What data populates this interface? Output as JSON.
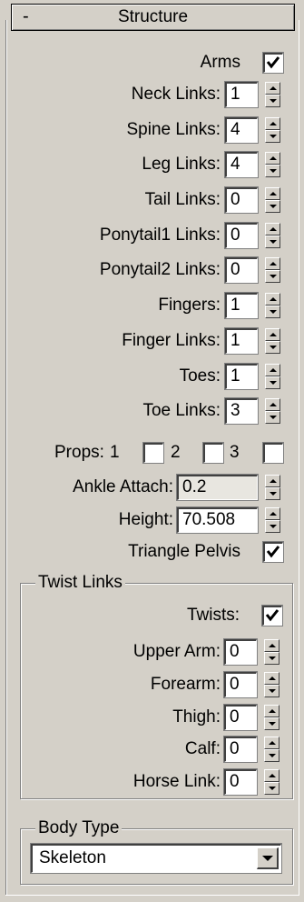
{
  "rollout": {
    "toggle": "-",
    "title": "Structure"
  },
  "arms": {
    "label": "Arms",
    "checked": true
  },
  "links": [
    {
      "label": "Neck Links:",
      "value": "1"
    },
    {
      "label": "Spine Links:",
      "value": "4"
    },
    {
      "label": "Leg Links:",
      "value": "4"
    },
    {
      "label": "Tail Links:",
      "value": "0"
    },
    {
      "label": "Ponytail1 Links:",
      "value": "0"
    },
    {
      "label": "Ponytail2 Links:",
      "value": "0"
    },
    {
      "label": "Fingers:",
      "value": "1"
    },
    {
      "label": "Finger Links:",
      "value": "1"
    },
    {
      "label": "Toes:",
      "value": "1"
    },
    {
      "label": "Toe Links:",
      "value": "3"
    }
  ],
  "props": {
    "label": "Props:",
    "p1": "1",
    "p2": "2",
    "p3": "3"
  },
  "ankle_attach": {
    "label": "Ankle Attach:",
    "value": "0.2"
  },
  "height": {
    "label": "Height:",
    "value": "70.508"
  },
  "triangle_pelvis": {
    "label": "Triangle Pelvis",
    "checked": true
  },
  "twist_links": {
    "title": "Twist Links",
    "twists": {
      "label": "Twists:",
      "checked": true
    },
    "fields": [
      {
        "label": "Upper Arm:",
        "value": "0"
      },
      {
        "label": "Forearm:",
        "value": "0"
      },
      {
        "label": "Thigh:",
        "value": "0"
      },
      {
        "label": "Calf:",
        "value": "0"
      },
      {
        "label": "Horse Link:",
        "value": "0"
      }
    ]
  },
  "body_type": {
    "title": "Body Type",
    "selected": "Skeleton"
  }
}
